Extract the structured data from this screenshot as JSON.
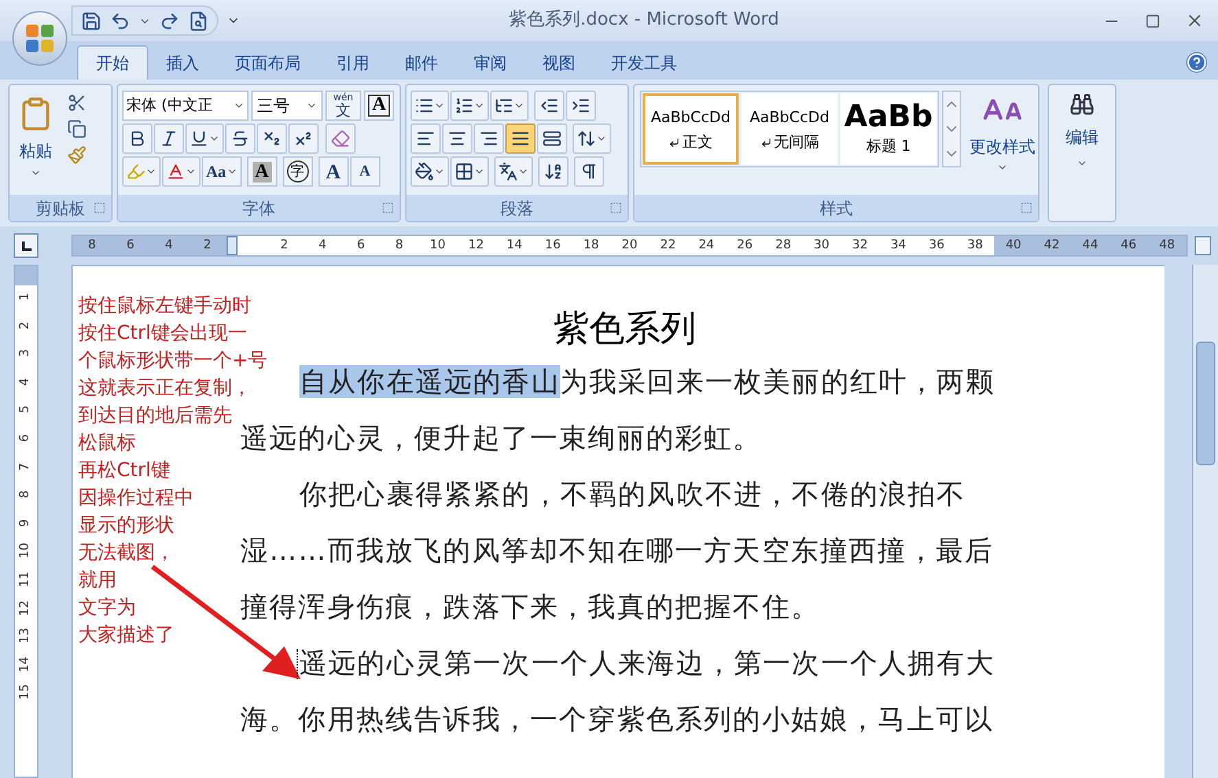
{
  "window": {
    "title": "紫色系列.docx - Microsoft Word"
  },
  "tabs": [
    {
      "label": "开始",
      "selected": true
    },
    {
      "label": "插入",
      "selected": false
    },
    {
      "label": "页面布局",
      "selected": false
    },
    {
      "label": "引用",
      "selected": false
    },
    {
      "label": "邮件",
      "selected": false
    },
    {
      "label": "审阅",
      "selected": false
    },
    {
      "label": "视图",
      "selected": false
    },
    {
      "label": "开发工具",
      "selected": false
    }
  ],
  "clipboard": {
    "paste": "粘贴",
    "label": "剪贴板"
  },
  "font": {
    "font_name": "宋体 (中文正",
    "font_size": "三号",
    "phonetic_top": "wén",
    "phonetic_bottom": "文",
    "char_border": "A",
    "change_case": "Aa",
    "char_shading": "A",
    "enclose": "字",
    "grow": "A",
    "shrink": "A",
    "label": "字体"
  },
  "paragraph": {
    "alignments": [
      {
        "kind": "left",
        "selected": false
      },
      {
        "kind": "center",
        "selected": false
      },
      {
        "kind": "right",
        "selected": false
      },
      {
        "kind": "justify",
        "selected": true
      },
      {
        "kind": "distributed",
        "selected": false
      }
    ],
    "label": "段落"
  },
  "styles": {
    "items": [
      {
        "preview": "AaBbCcDd",
        "name": "正文",
        "paragraph_mark": true,
        "selected": true
      },
      {
        "preview": "AaBbCcDd",
        "name": "无间隔",
        "paragraph_mark": true,
        "selected": false
      },
      {
        "preview": "AaBb",
        "name": "标题 1",
        "paragraph_mark": false,
        "selected": false
      }
    ],
    "change_styles": "更改样式",
    "label": "样式"
  },
  "editing": {
    "label": "编辑"
  },
  "ruler": {
    "left_numbers": [
      "8",
      "6",
      "4",
      "2"
    ],
    "right_numbers": [
      "2",
      "4",
      "6",
      "8",
      "10",
      "12",
      "14",
      "16",
      "18",
      "20",
      "22",
      "24",
      "26",
      "28",
      "30",
      "32",
      "34",
      "36",
      "38",
      "40",
      "42",
      "44",
      "46",
      "48"
    ]
  },
  "vertical_ruler": {
    "numbers": [
      "1",
      "2",
      "3",
      "4",
      "5",
      "6",
      "7",
      "8",
      "9",
      "10",
      "11",
      "12",
      "13",
      "14",
      "15"
    ]
  },
  "annotation": {
    "lines": [
      "按住鼠标左键手动时",
      "按住Ctrl键会出现一",
      "个鼠标形状带一个+号",
      "这就表示正在复制，",
      "到达目的地后需先",
      "松鼠标",
      "再松Ctrl键",
      "因操作过程中",
      "显示的形状",
      "无法截图，",
      "就用",
      "文字为",
      "大家描述了"
    ]
  },
  "document": {
    "title": "紫色系列",
    "paragraphs": [
      {
        "selected_text": "自从你在遥远的香山",
        "text": "为我采回来一枚美丽的红叶，两颗遥远的心灵，便升起了一束绚丽的彩虹。",
        "cursor": false
      },
      {
        "text": "你把心裹得紧紧的，不羁的风吹不进，不倦的浪拍不湿……而我放飞的风筝却不知在哪一方天空东撞西撞，最后撞得浑身伤痕，跌落下来，我真的把握不住。",
        "cursor": false
      },
      {
        "text": "遥远的心灵第一次一个人来海边，第一次一个人拥有大海。你用热线告诉我，一个穿紫色系列的小姑娘，马上可以",
        "cursor": true
      }
    ]
  }
}
